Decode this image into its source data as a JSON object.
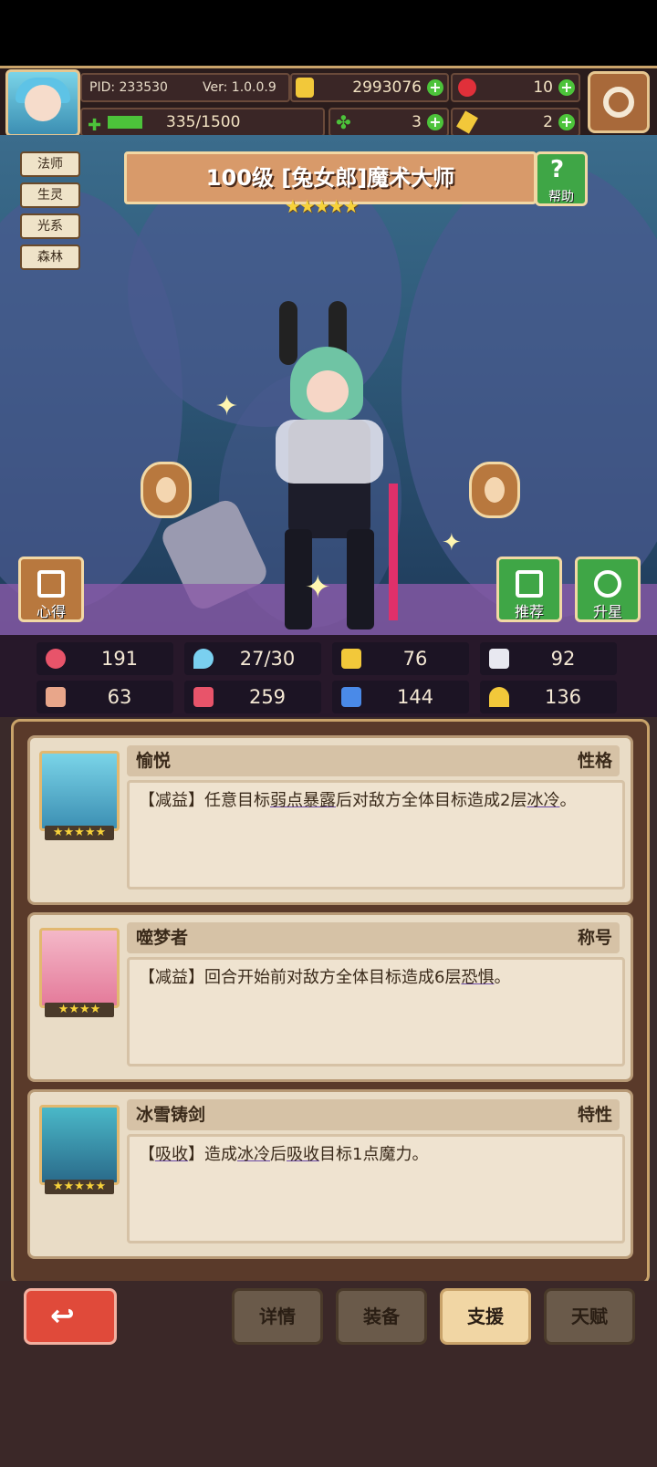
{
  "hud": {
    "pid": "PID: 233530",
    "version": "Ver: 1.0.0.9",
    "gold": "2993076",
    "red_gem": "10",
    "exp": "335/1500",
    "clover": "3",
    "key": "2"
  },
  "tags": [
    "法师",
    "生灵",
    "光系",
    "森林"
  ],
  "hero": {
    "title": "100级  [兔女郎]魔术大师",
    "stars": "★★★★★"
  },
  "buttons": {
    "help": "帮助",
    "notes": "心得",
    "recommend": "推荐",
    "star_up": "升星"
  },
  "stats": [
    {
      "icon": "heart-icon",
      "value": "191",
      "color": "#e8546a"
    },
    {
      "icon": "water-drop-icon",
      "value": "27/30",
      "color": "#7ad0f0"
    },
    {
      "icon": "shield-icon",
      "value": "76",
      "color": "#f2c83a"
    },
    {
      "icon": "wing-icon",
      "value": "92",
      "color": "#e8e8f0"
    },
    {
      "icon": "fist-icon",
      "value": "63",
      "color": "#e8a68a"
    },
    {
      "icon": "book-icon",
      "value": "259",
      "color": "#e8546a"
    },
    {
      "icon": "boot-icon",
      "value": "144",
      "color": "#4a8ae8"
    },
    {
      "icon": "horseshoe-icon",
      "value": "136",
      "color": "#f2c83a"
    }
  ],
  "cards": [
    {
      "name": "愉悦",
      "type": "性格",
      "stars": "★★★★★",
      "desc_a": "【减益】任意目标",
      "desc_u1": "弱点暴露",
      "desc_b": "后对敌方全体目标造成2层",
      "desc_u2": "冰冷",
      "desc_c": "。"
    },
    {
      "name": "噬梦者",
      "type": "称号",
      "stars": "★★★★",
      "desc_a": "【减益】回合开始前对敌方全体目标造成6层",
      "desc_u1": "恐惧",
      "desc_b": "。",
      "desc_u2": "",
      "desc_c": ""
    },
    {
      "name": "冰雪铸剑",
      "type": "特性",
      "stars": "★★★★★",
      "desc_a": "【",
      "desc_u1": "吸收",
      "desc_b": "】造成",
      "desc_u2": "冰冷",
      "desc_c": "后",
      "desc_u3": "吸收",
      "desc_d": "目标1点魔力。"
    }
  ],
  "nav": {
    "back": "↩",
    "details": "详情",
    "equip": "装备",
    "support": "支援",
    "talent": "天赋"
  }
}
